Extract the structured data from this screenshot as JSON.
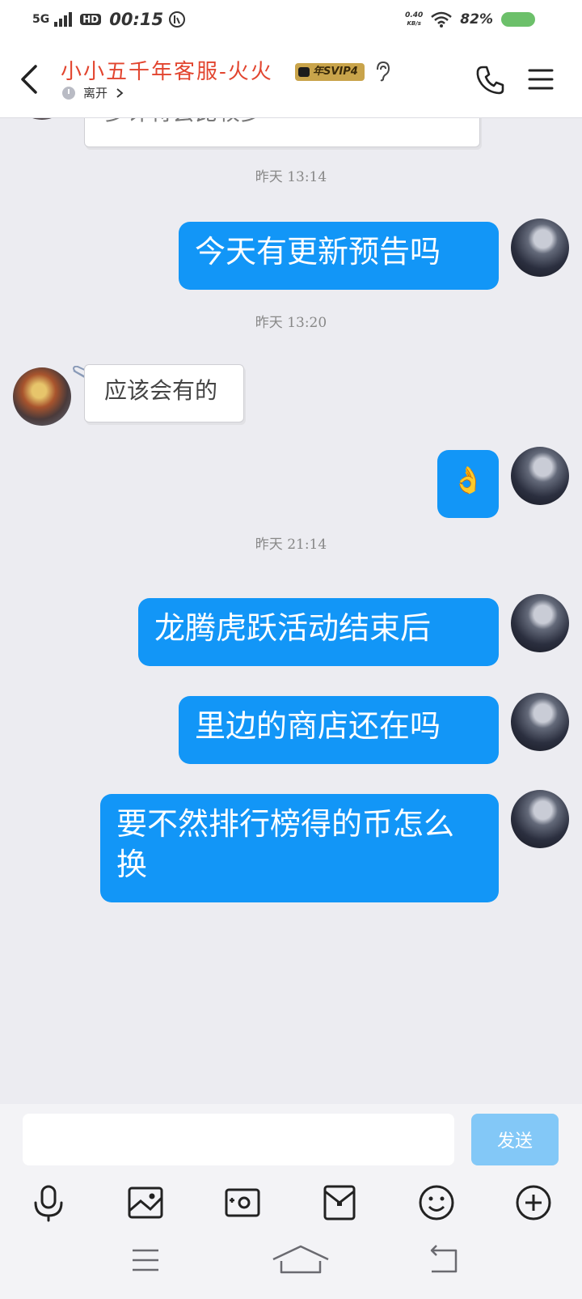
{
  "status": {
    "network": "5G",
    "hd": "HD",
    "time": "00:15",
    "speed_value": "0.40",
    "speed_unit": "KB/s",
    "battery": "82%",
    "battery_color": "#6cc06a"
  },
  "header": {
    "title": "小小五千年客服-火火",
    "badge": "年SVIP4",
    "presence": "离开",
    "title_color": "#e2452f"
  },
  "messages": {
    "partial_text": "多许将会比较多",
    "t1": "昨天 13:14",
    "m1": "今天有更新预告吗",
    "t2": "昨天 13:20",
    "m2": "应该会有的",
    "m3": "👌",
    "t3": "昨天 21:14",
    "m4": "龙腾虎跃活动结束后",
    "m5": "里边的商店还在吗",
    "m6": "要不然排行榜得的币怎么换"
  },
  "input": {
    "placeholder": "",
    "send_label": "发送"
  },
  "colors": {
    "bubble_out": "#1296f7",
    "send_disabled": "#83c8f7",
    "background": "#ececf1"
  }
}
